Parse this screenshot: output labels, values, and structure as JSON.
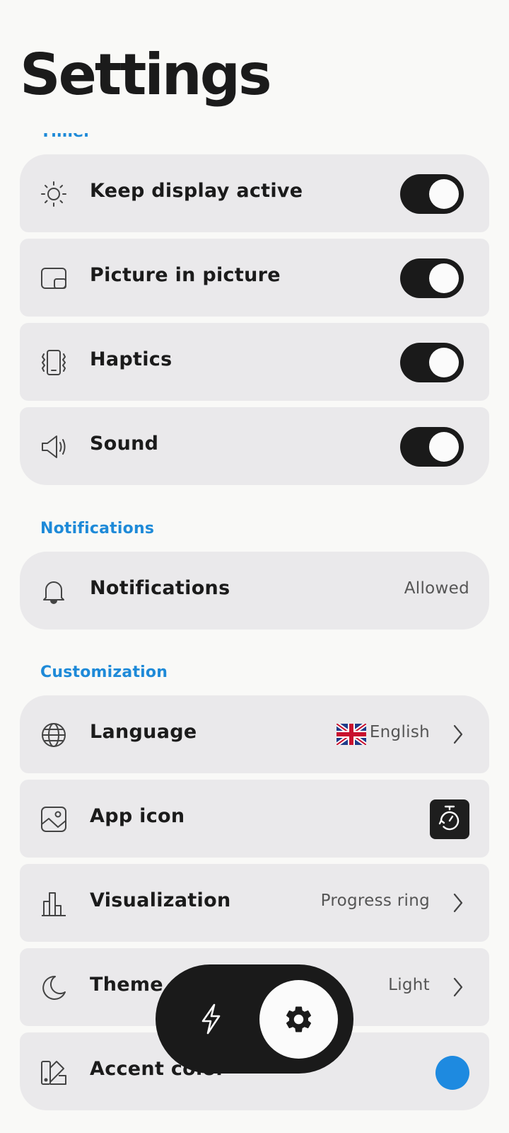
{
  "header": {
    "title": "Settings"
  },
  "sections": {
    "timer": {
      "label": "Timer"
    },
    "notifications": {
      "label": "Notifications"
    },
    "customization": {
      "label": "Customization"
    }
  },
  "timer_rows": {
    "keep_display": {
      "label": "Keep display active",
      "icon": "sun-icon",
      "toggle": true
    },
    "pip": {
      "label": "Picture in picture",
      "icon": "picture-in-picture-icon",
      "toggle": true
    },
    "haptics": {
      "label": "Haptics",
      "icon": "vibrating-phone-icon",
      "toggle": true
    },
    "sound": {
      "label": "Sound",
      "icon": "speaker-icon",
      "toggle": true
    }
  },
  "notification_row": {
    "label": "Notifications",
    "value": "Allowed",
    "icon": "bell-icon"
  },
  "custom_rows": {
    "language": {
      "label": "Language",
      "value": "English",
      "icon": "globe-icon",
      "flag": "uk-flag"
    },
    "app_icon": {
      "label": "App icon",
      "icon": "image-icon",
      "preview": "stopwatch-app-icon"
    },
    "visualization": {
      "label": "Visualization",
      "value": "Progress ring",
      "icon": "bar-chart-icon"
    },
    "theme": {
      "label": "Theme",
      "value": "Light",
      "icon": "moon-icon"
    },
    "accent": {
      "label": "Accent color",
      "icon": "palette-icon",
      "color": "#1e8ae0"
    }
  },
  "bottom_nav": {
    "items": [
      {
        "name": "Quick start",
        "icon": "lightning-icon",
        "active": false
      },
      {
        "name": "Settings",
        "icon": "gear-icon",
        "active": true
      }
    ]
  },
  "colors": {
    "accent_label": "#1e8ad8",
    "row_background": "#eae9eb",
    "toggle_on": "#1a1a1a",
    "page_background": "#f9f9f7"
  }
}
